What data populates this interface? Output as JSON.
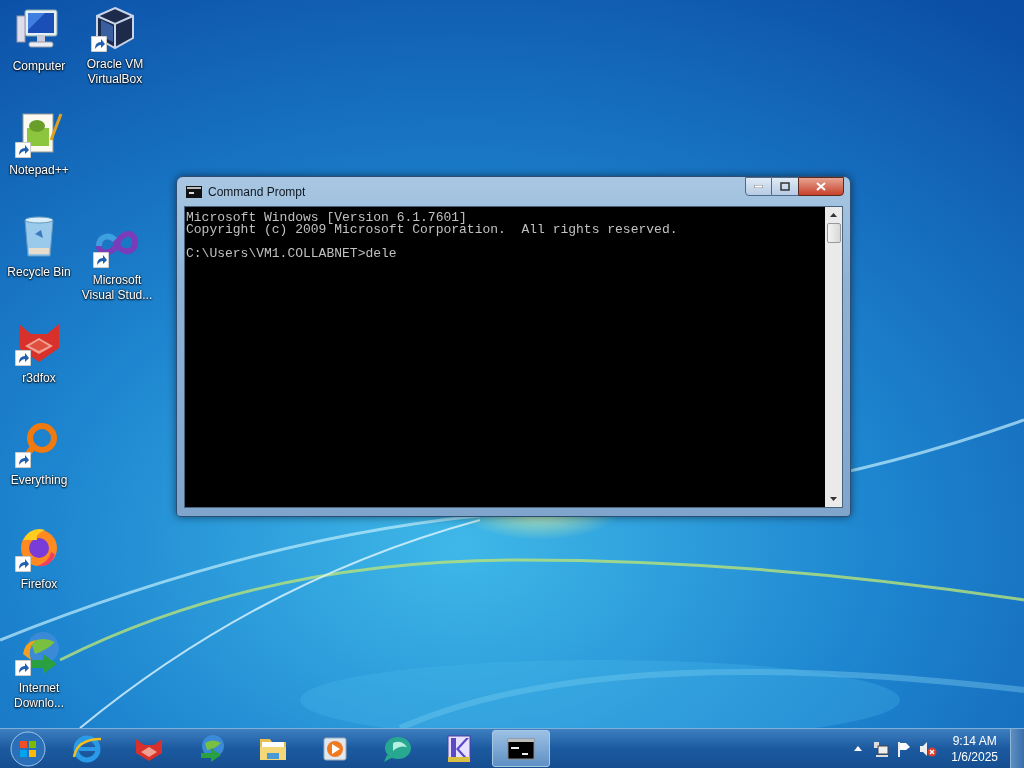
{
  "desktop": {
    "icons": [
      {
        "label": "Computer",
        "shortcut": false
      },
      {
        "label": "Oracle VM VirtualBox",
        "shortcut": true
      },
      {
        "label": "Notepad++",
        "shortcut": true
      },
      {
        "label": "Recycle Bin",
        "shortcut": false
      },
      {
        "label": "Microsoft Visual Stud...",
        "shortcut": true
      },
      {
        "label": "r3dfox",
        "shortcut": true
      },
      {
        "label": "Everything",
        "shortcut": true
      },
      {
        "label": "Firefox",
        "shortcut": true
      },
      {
        "label": "Internet Downlo...",
        "shortcut": true
      }
    ]
  },
  "window": {
    "title": "Command Prompt",
    "paragraphs": [
      [
        "Microsoft Windows [Version 6.1.7601]",
        "Copyright (c) 2009 Microsoft Corporation.  All rights reserved."
      ],
      [
        "C:\\Users\\VM1.COLLABNET>dele"
      ]
    ]
  },
  "taskbar": {
    "items": [
      {
        "selected": false
      },
      {
        "selected": false
      },
      {
        "selected": false
      },
      {
        "selected": false
      },
      {
        "selected": false
      },
      {
        "selected": false
      },
      {
        "selected": false
      },
      {
        "selected": true
      }
    ],
    "clock": {
      "time": "9:14 AM",
      "date": "1/6/2025"
    }
  }
}
